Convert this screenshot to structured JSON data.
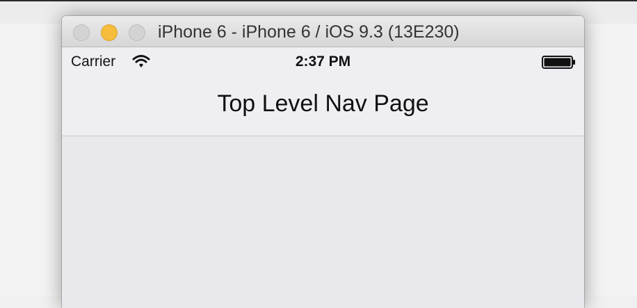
{
  "window": {
    "title": "iPhone 6 - iPhone 6 / iOS 9.3 (13E230)",
    "buttons": {
      "close": "close-button",
      "minimize": "minimize-button",
      "zoom": "zoom-button"
    }
  },
  "status_bar": {
    "carrier": "Carrier",
    "time": "2:37 PM",
    "icons": [
      "wifi-icon",
      "battery-icon"
    ]
  },
  "nav_bar": {
    "title": "Top Level Nav Page"
  },
  "colors": {
    "minimize_yellow": "#f5bd3b",
    "inactive_button": "#d3d3d3",
    "nav_background": "#efeff3",
    "content_background": "#e9e8ed"
  }
}
